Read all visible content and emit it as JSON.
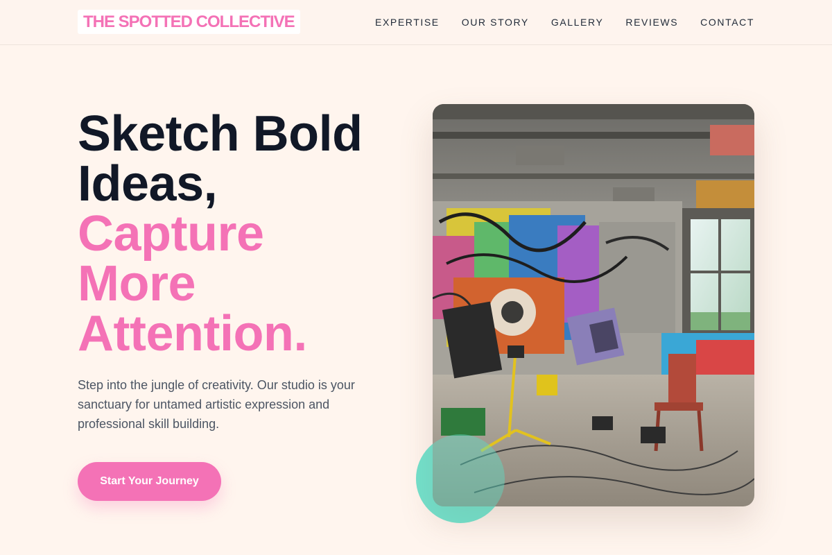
{
  "header": {
    "logo": "THE SPOTTED COLLECTIVE",
    "nav": [
      {
        "label": "EXPERTISE"
      },
      {
        "label": "OUR STORY"
      },
      {
        "label": "GALLERY"
      },
      {
        "label": "REVIEWS"
      },
      {
        "label": "CONTACT"
      }
    ]
  },
  "hero": {
    "title_lines": [
      "Sketch Bold",
      "Ideas,"
    ],
    "accent_lines": [
      "Capture",
      "More",
      "Attention."
    ],
    "description": "Step into the jungle of creativity. Our studio is your sanctuary for untamed artistic expression and professional skill building.",
    "cta_label": "Start Your Journey",
    "image_alt": "Graffiti-covered art studio with easels, chairs and lights"
  },
  "colors": {
    "background": "#fff5ee",
    "accent_pink": "#f472b6",
    "heading_dark": "#111827",
    "body_text": "#4b5563",
    "teal_blob": "#5edbc4"
  }
}
